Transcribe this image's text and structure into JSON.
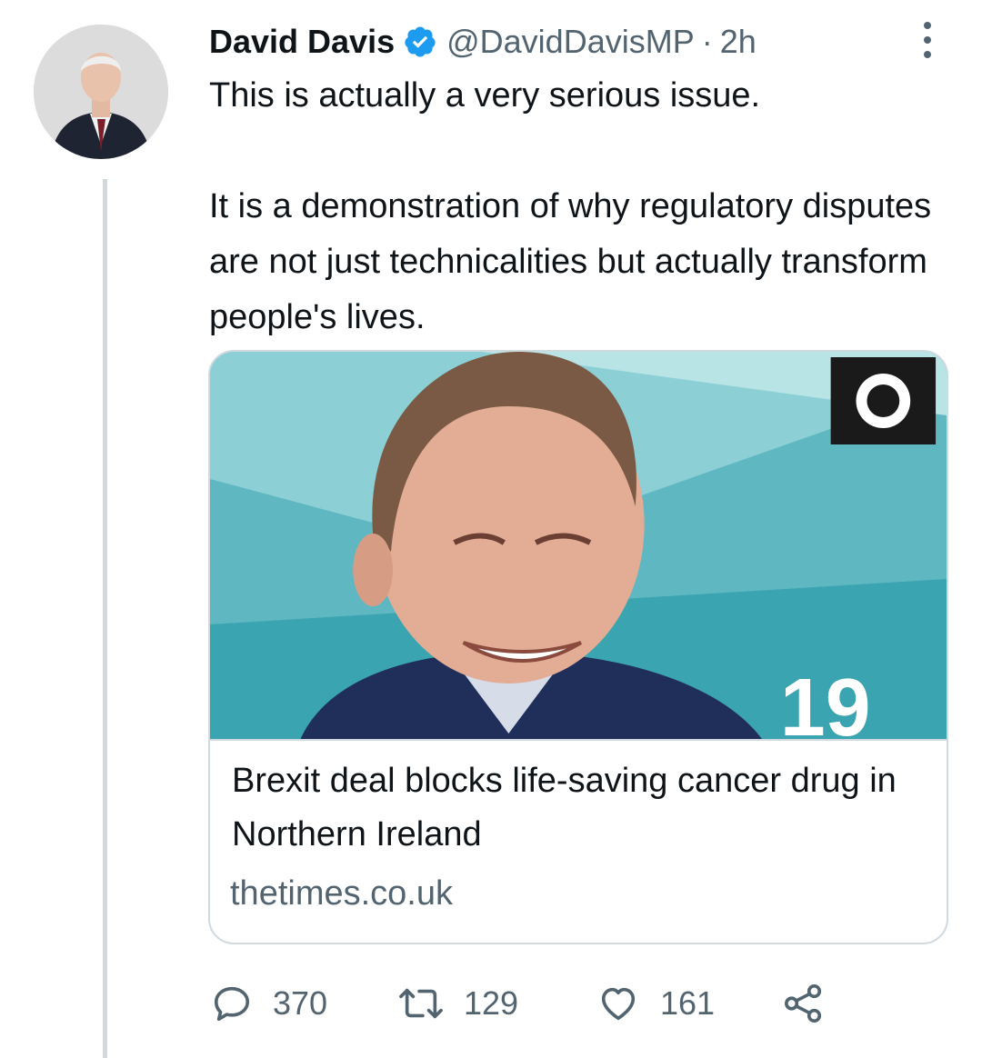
{
  "tweet": {
    "author_name": "David Davis",
    "handle": "@DavidDavisMP",
    "separator": "·",
    "time": "2h",
    "text": "This is actually a very serious issue.\n\nIt is a demonstration of why regulatory disputes are not just technicalities but actually transform people's lives.",
    "verified": true
  },
  "card": {
    "title": "Brexit deal blocks life-saving cancer drug in Northern Ireland",
    "domain": "thetimes.co.uk",
    "image_backdrop_text": "19"
  },
  "actions": {
    "replies": "370",
    "retweets": "129",
    "likes": "161"
  },
  "icons": {
    "verified": "verified-badge-icon",
    "more": "more-vertical-icon",
    "reply": "reply-icon",
    "retweet": "retweet-icon",
    "like": "heart-icon",
    "share": "share-icon"
  },
  "colors": {
    "verified_blue": "#1d9bf0",
    "secondary_text": "#536471",
    "border": "#cfd9de"
  }
}
